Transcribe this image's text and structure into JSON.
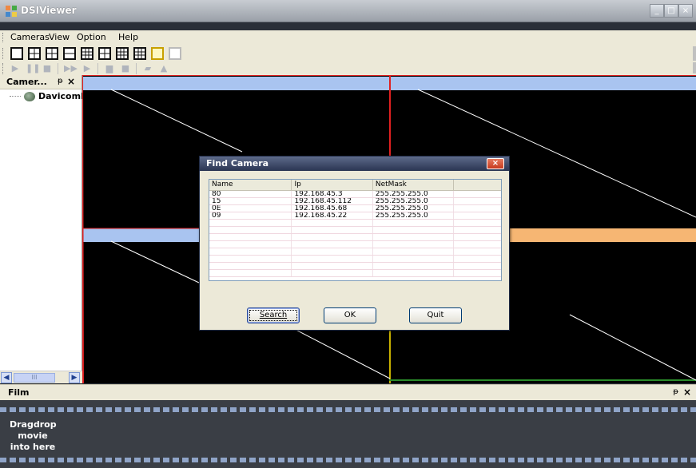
{
  "window": {
    "title": "DSIViewer"
  },
  "menu": {
    "items": [
      "Cameras",
      "View",
      "Option",
      "Help"
    ]
  },
  "camera_panel": {
    "title": "Camer...",
    "tree_root": "DavicomIp"
  },
  "film_panel": {
    "title": "Film",
    "hint_line1": "Dragdrop",
    "hint_line2": "movie",
    "hint_line3": "into here"
  },
  "dialog": {
    "title": "Find Camera",
    "columns": [
      "Name",
      "Ip",
      "NetMask",
      ""
    ],
    "rows": [
      {
        "name": "80",
        "ip": "192.168.45.3",
        "netmask": "255.255.255.0"
      },
      {
        "name": "15",
        "ip": "192.168.45.112",
        "netmask": "255.255.255.0"
      },
      {
        "name": "0E",
        "ip": "192.168.45.68",
        "netmask": "255.255.255.0"
      },
      {
        "name": "09",
        "ip": "192.168.45.22",
        "netmask": "255.255.255.0"
      }
    ],
    "buttons": {
      "search": "Search",
      "ok": "OK",
      "quit": "Quit"
    }
  },
  "icons": {
    "pin": "pin-icon",
    "close": "close-icon",
    "scroll_left": "◀",
    "scroll_right": "▶",
    "scroll_thumb": "III",
    "win_minimize": "_",
    "win_maximize": "□",
    "win_close": "×"
  },
  "colors": {
    "accent_blue": "#a9c4f0",
    "accent_orange": "#f6b673",
    "divider_red": "#e02020",
    "divider_yellow": "#c8b000"
  }
}
